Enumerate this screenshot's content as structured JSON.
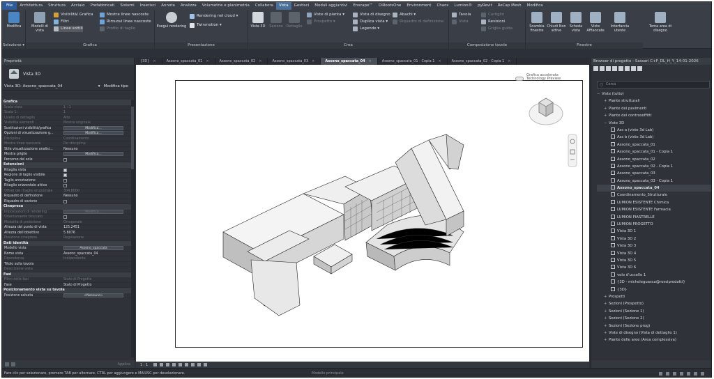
{
  "menu": [
    "File",
    "Architettura",
    "Struttura",
    "Acciaio",
    "Prefabbricati",
    "Sistemi",
    "Inserisci",
    "Annota",
    "Analizza",
    "Volumetrie e planimetria",
    "Collabora",
    "Vista",
    "Gestisci",
    "Moduli aggiuntivi",
    "Enscape™",
    "DiRootsOne",
    "Environment",
    "Chaos",
    "Lumion®",
    "pyRevit",
    "ReCap Mesh",
    "Modifica"
  ],
  "ribbon": {
    "modifica": "Modifica",
    "selezione": "Selezione ▾",
    "modelli_vista": "Modelli di vista",
    "filtri": "Filtri",
    "linee_sottili": "Linee sottili",
    "visibilita": "Visibilità/ Grafica",
    "mostra_nascoste": "Mostra linee nascoste",
    "rimuovi_nascoste": "Rimuovi linee nascoste",
    "profilo_taglio": "Profilo di taglio",
    "grafica_title": "Grafica",
    "esegui_rendering": "Esegui rendering",
    "rendering_cloud": "Rendering nel cloud ▾",
    "twinmotion": "Twinmotion ▾",
    "presentazione_title": "Presentazione",
    "vista_3d": "Vista 3D",
    "sezione": "Sezione",
    "dettaglio": "Dettaglio",
    "viste_pianta": "Viste di pianta ▾",
    "prospetto": "Prospetto ▾",
    "vista_disegno": "Vista di disegno",
    "duplica_vista": "Duplica vista ▾",
    "legende": "Legende ▾",
    "abachi": "Abachi ▾",
    "riquadro_def": "Riquadro di definizione",
    "crea_title": "Crea",
    "tavola": "Tavola",
    "cartiglio": "Cartiglio",
    "vista": "Vista",
    "revisioni": "Revisioni",
    "griglia_guida": "Griglia guida",
    "composizione_title": "Composizione tavole",
    "scambia": "Scambia finestre",
    "chiudi": "Chiudi Non attive",
    "scheda": "Scheda vista",
    "affiancate": "Viste Affiancate",
    "interfaccia": "Interfaccia utente",
    "tema": "Tema area di disegno",
    "finestre_title": "Finestre"
  },
  "properties": {
    "header": "Proprietà",
    "type_name": "Vista 3D",
    "selector": "Vista 3D: Assono_spaccata_04",
    "edit_type": "Modifica tipo",
    "rows": [
      {
        "section": "Grafica"
      },
      {
        "k": "Scala vista",
        "v": "1 : 1",
        "dis": true
      },
      {
        "k": "Scala 1 :",
        "v": "1",
        "dis": true
      },
      {
        "k": "Livello di dettaglio",
        "v": "Alto",
        "dis": true
      },
      {
        "k": "Visibilità elementi",
        "v": "Mostra originale",
        "dis": true
      },
      {
        "k": "Sostituzioni visibilità/grafica",
        "btn": "Modifica..."
      },
      {
        "k": "Opzioni di visualizzazione g...",
        "btn": "Modifica..."
      },
      {
        "k": "Disciplina",
        "v": "Coordinamento",
        "dis": true
      },
      {
        "k": "Mostra linee nascoste",
        "v": "Per disciplina",
        "dis": true
      },
      {
        "k": "Stile visualizzazione analisi...",
        "v": "Nessuno"
      },
      {
        "k": "Mostra griglie",
        "btn": "Modifica..."
      },
      {
        "k": "Percorso del sole",
        "chk": false
      },
      {
        "section": "Estensioni"
      },
      {
        "k": "Ritaglia vista",
        "chk": true
      },
      {
        "k": "Regione di taglio visibile",
        "chk": true
      },
      {
        "k": "Taglio annotazione",
        "chk": false
      },
      {
        "k": "Ritaglio orizzontale attivo",
        "chk": false
      },
      {
        "k": "Offset del ritaglio orizzontale",
        "v": "304.8000",
        "dis": true
      },
      {
        "k": "Riquadro di definizione",
        "v": "Nessuno"
      },
      {
        "k": "Riquadro di sezione",
        "chk": false
      },
      {
        "section": "Cinepresa"
      },
      {
        "k": "Impostazioni di rendering",
        "btn": "Modifica...",
        "dis": true
      },
      {
        "k": "Orientamento bloccato",
        "chk": false,
        "dis": true
      },
      {
        "k": "Modalità di proiezione",
        "v": "Ortogonale",
        "dis": true
      },
      {
        "k": "Altezza del punto di vista",
        "v": "125.2451"
      },
      {
        "k": "Altezza dell'obiettivo",
        "v": "5.8076"
      },
      {
        "k": "Posizione cinepresa",
        "v": "Regolazione",
        "dis": true
      },
      {
        "section": "Dati identità"
      },
      {
        "k": "Modello vista",
        "btn": "Assono_spaccata"
      },
      {
        "k": "Nome vista",
        "v": "Assono_spaccata_04"
      },
      {
        "k": "Dipendenza",
        "v": "Indipendente",
        "dis": true
      },
      {
        "k": "Titolo sulla tavola",
        "v": ""
      },
      {
        "k": "Descrizione vista",
        "v": "",
        "dis": true
      },
      {
        "section": "Fasi"
      },
      {
        "k": "Filtro delle fasi",
        "v": "Stato di Progetto",
        "dis": true
      },
      {
        "k": "Fase",
        "v": "Stato di Progetto"
      },
      {
        "section": "Posizionamento vista su tavola"
      },
      {
        "k": "Posizione salvata",
        "btn": "<Nessuno>"
      }
    ],
    "apply": "Applica"
  },
  "tabs": [
    "{3D}",
    "Assono_spaccata_01",
    "Assono_spaccata_02",
    "Assono_spaccata_03",
    "Assono_spaccata_04",
    "Assono_spaccata_01 - Copia 1",
    "Assono_spaccata_02 - Copia 1"
  ],
  "active_tab": 4,
  "viewport": {
    "accel_label_1": "Grafica accelerata",
    "accel_label_2": "Technology Preview",
    "scale": "1 : 1"
  },
  "browser": {
    "header": "Browser di progetto - Sassari C+F_DL_H_Y_14-01-2026",
    "search_placeholder": "Cerca",
    "nodes": [
      {
        "t": "Viste (tutto)",
        "lvl": 0,
        "pm": "−",
        "root": true
      },
      {
        "t": "Piante strutturali",
        "lvl": 1,
        "pm": "+"
      },
      {
        "t": "Piante dei pavimenti",
        "lvl": 1,
        "pm": "+"
      },
      {
        "t": "Piante dei controsoffitti",
        "lvl": 1,
        "pm": "+"
      },
      {
        "t": "Viste 3D",
        "lvl": 1,
        "pm": "−"
      },
      {
        "t": "Ass a (viste 3d Lab)",
        "lvl": 2
      },
      {
        "t": "Ass b (viste 3d Lab)",
        "lvl": 2
      },
      {
        "t": "Assono_spaccata_01",
        "lvl": 2
      },
      {
        "t": "Assono_spaccata_01 - Copia 1",
        "lvl": 2
      },
      {
        "t": "Assono_spaccata_02",
        "lvl": 2
      },
      {
        "t": "Assono_spaccata_02 - Copia 1",
        "lvl": 2
      },
      {
        "t": "Assono_spaccata_03",
        "lvl": 2
      },
      {
        "t": "Assono_spaccata_03 - Copia 1",
        "lvl": 2
      },
      {
        "t": "Assono_spaccata_04",
        "lvl": 2,
        "bold": true
      },
      {
        "t": "Coordinamento_Strutturale",
        "lvl": 2
      },
      {
        "t": "LUMION ESISTENTE Chimica",
        "lvl": 2
      },
      {
        "t": "LUMION ESISTENTE Farmacia",
        "lvl": 2
      },
      {
        "t": "LUMION PIASTRELLE",
        "lvl": 2
      },
      {
        "t": "LUMION PROGETTO",
        "lvl": 2
      },
      {
        "t": "Vista 3D 1",
        "lvl": 2
      },
      {
        "t": "Vista 3D 2",
        "lvl": 2
      },
      {
        "t": "Vista 3D 3",
        "lvl": 2
      },
      {
        "t": "Vista 3D 4",
        "lvl": 2
      },
      {
        "t": "Vista 3D 5",
        "lvl": 2
      },
      {
        "t": "Vista 3D 6",
        "lvl": 2
      },
      {
        "t": "volo d'uccello 1",
        "lvl": 2
      },
      {
        "t": "{3D - micheleguasco@rossiprodotti}",
        "lvl": 2
      },
      {
        "t": "{3D}",
        "lvl": 2
      },
      {
        "t": "Prospetti",
        "lvl": 1,
        "pm": "+"
      },
      {
        "t": "Sezioni (Prospetto)",
        "lvl": 1,
        "pm": "+"
      },
      {
        "t": "Sezioni (Sezione 1)",
        "lvl": 1,
        "pm": "+"
      },
      {
        "t": "Sezioni (Sezione 2)",
        "lvl": 1,
        "pm": "+"
      },
      {
        "t": "Sezioni (Sezione prog)",
        "lvl": 1,
        "pm": "+"
      },
      {
        "t": "Viste di disegno (Vista di dettaglio 1)",
        "lvl": 1,
        "pm": "+"
      },
      {
        "t": "Piante delle aree (Area complessiva)",
        "lvl": 1,
        "pm": "+"
      }
    ]
  },
  "status": {
    "text": "Fare clic per selezionare, premere TAB per alternare, CTRL per aggiungere e MAIUSC per deselezionare.",
    "model": "Modello principale"
  },
  "colors": {
    "accent": "#4a6f98",
    "file_button": "#2e5b9a",
    "panel_bg": "#2f3339"
  }
}
